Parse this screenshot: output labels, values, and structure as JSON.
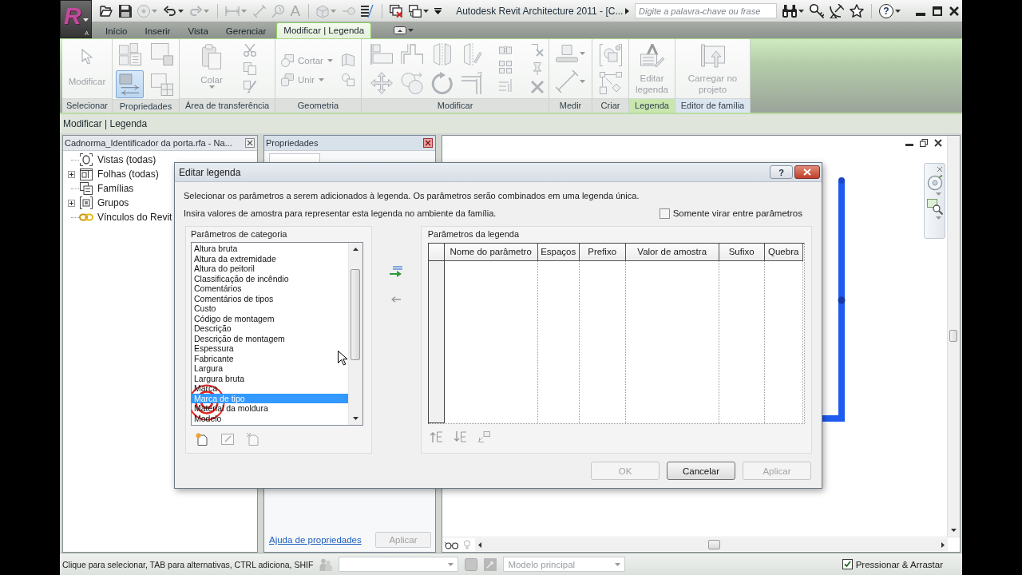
{
  "app_button": {
    "logo": "R",
    "keytip": "A"
  },
  "title_bar": {
    "text_tool": "A",
    "title": "Autodesk Revit Architecture 2011 - [C...",
    "search": {
      "placeholder": "Digite a palavra-chave ou frase"
    },
    "help": "?"
  },
  "ribbon": {
    "tabs": [
      {
        "label": "Início",
        "selected": false
      },
      {
        "label": "Inserir",
        "selected": false
      },
      {
        "label": "Vista",
        "selected": false
      },
      {
        "label": "Gerenciar",
        "selected": false
      },
      {
        "label": "Modificar | Legenda",
        "selected": true
      }
    ],
    "panels": [
      {
        "label": "Selecionar",
        "tools": [
          {
            "label": "Modificar",
            "disabled": true
          }
        ]
      },
      {
        "label": "Propriedades",
        "tools": [
          {
            "selected": false
          },
          {
            "selected": false
          },
          {
            "selected": true
          },
          {
            "selected": false
          }
        ]
      },
      {
        "label": "Área de transferência",
        "tools": [
          {
            "label": "Colar",
            "disabled": true
          }
        ]
      },
      {
        "label": "Geometria",
        "tools": [
          {
            "label": "Cortar",
            "disabled": true
          },
          {
            "label": "Unir",
            "disabled": true
          }
        ]
      },
      {
        "label": "Modificar"
      },
      {
        "label": "Medir"
      },
      {
        "label": "Criar"
      },
      {
        "label": "Legenda",
        "color": "#c8e6ae",
        "tools": [
          {
            "label": "Editar legenda",
            "disabled": true
          }
        ]
      },
      {
        "label": "Editor de família",
        "color": "#dbe5ef",
        "tools": [
          {
            "label": "Carregar no projeto",
            "disabled": true
          }
        ]
      }
    ]
  },
  "options_bar": {
    "label": "Modificar | Legenda"
  },
  "project_browser": {
    "title": "Cadnorma_Identificador da porta.rfa - Na...",
    "items": [
      {
        "kind": "views",
        "label": "Vistas (todas)"
      },
      {
        "kind": "sheets",
        "label": "Folhas (todas)",
        "expanded": false
      },
      {
        "kind": "families",
        "label": "Famílias"
      },
      {
        "kind": "groups",
        "label": "Grupos",
        "expanded": false
      },
      {
        "kind": "links",
        "label": "Vínculos do Revit"
      }
    ]
  },
  "properties": {
    "title": "Propriedades",
    "help_link": "Ajuda de propriedades",
    "apply": {
      "label": "Aplicar",
      "disabled": true
    }
  },
  "dialog": {
    "title": "Editar legenda",
    "help": "?",
    "intro": "Selecionar os parâmetros a serem adicionados à legenda. Os parâmetros serão combinados em uma legenda única.",
    "hint": "Insira valores de amostra para representar esta legenda no ambiente da família.",
    "flip_only": {
      "label": "Somente virar entre parâmetros",
      "checked": false
    },
    "category_parameters": {
      "title": "Parâmetros de categoria",
      "items": [
        {
          "label": "Altura bruta",
          "selected": false
        },
        {
          "label": "Altura da extremidade",
          "selected": false
        },
        {
          "label": "Altura do peitoril",
          "selected": false
        },
        {
          "label": "Classificação de incêndio",
          "selected": false
        },
        {
          "label": "Comentários",
          "selected": false
        },
        {
          "label": "Comentários de tipos",
          "selected": false
        },
        {
          "label": "Custo",
          "selected": false
        },
        {
          "label": "Código de montagem",
          "selected": false
        },
        {
          "label": "Descrição",
          "selected": false
        },
        {
          "label": "Descrição de montagem",
          "selected": false
        },
        {
          "label": "Espessura",
          "selected": false
        },
        {
          "label": "Fabricante",
          "selected": false
        },
        {
          "label": "Largura",
          "selected": false
        },
        {
          "label": "Largura bruta",
          "selected": false
        },
        {
          "label": "Marca",
          "selected": false
        },
        {
          "label": "Marca de tipo",
          "selected": true
        },
        {
          "label": "Material da moldura",
          "selected": false
        },
        {
          "label": "Modelo",
          "selected": false
        }
      ]
    },
    "legend_parameters": {
      "title": "Parâmetros da legenda",
      "columns": [
        "Nome do parâmetro",
        "Espaços",
        "Prefixo",
        "Valor de amostra",
        "Sufixo",
        "Quebra"
      ]
    },
    "buttons": [
      {
        "label": "OK",
        "disabled": true
      },
      {
        "label": "Cancelar",
        "disabled": false
      },
      {
        "label": "Aplicar",
        "disabled": true
      }
    ]
  },
  "status_bar": {
    "hint": "Clique para selecionar, TAB para alternativas, CTRL adiciona, SHIF",
    "design_option": {
      "value": "Modelo principal",
      "disabled": true
    },
    "press_drag": {
      "label": "Pressionar & Arrastar",
      "checked": true
    }
  }
}
